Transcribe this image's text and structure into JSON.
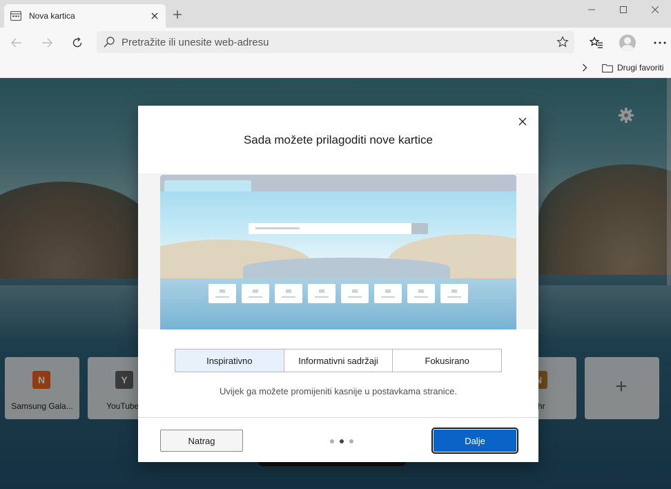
{
  "tab": {
    "title": "Nova kartica",
    "favicon": "newtab-page-icon",
    "close": "close-icon"
  },
  "window": {
    "minimize": "minimize-icon",
    "maximize": "maximize-icon",
    "close": "close-icon"
  },
  "address": {
    "placeholder": "Pretražite ili unesite web-adresu"
  },
  "favorites_bar": {
    "folder_label": "Drugi favoriti"
  },
  "tiles": [
    {
      "label": "Samsung Gala...",
      "icon_letter": "N",
      "color": "#e8601c"
    },
    {
      "label": "YouTube I",
      "icon_letter": "Y",
      "color": "#5f5f5f"
    },
    {
      "label": "t.hr",
      "icon_letter": "N",
      "color": "#b07a2a"
    },
    {
      "label": "",
      "icon_letter": "+",
      "color": "#666666"
    }
  ],
  "dialog": {
    "title": "Sada možete prilagoditi nove kartice",
    "options": [
      "Inspirativno",
      "Informativni sadržaji",
      "Fokusirano"
    ],
    "selected_option": "Inspirativno",
    "hint": "Uvijek ga možete promijeniti kasnije u postavkama stranice.",
    "back_label": "Natrag",
    "next_label": "Dalje",
    "pages_total": 3,
    "current_page": 2
  },
  "colors": {
    "accent": "#0a64c8",
    "selected_option_bg": "#e8f1fb"
  }
}
